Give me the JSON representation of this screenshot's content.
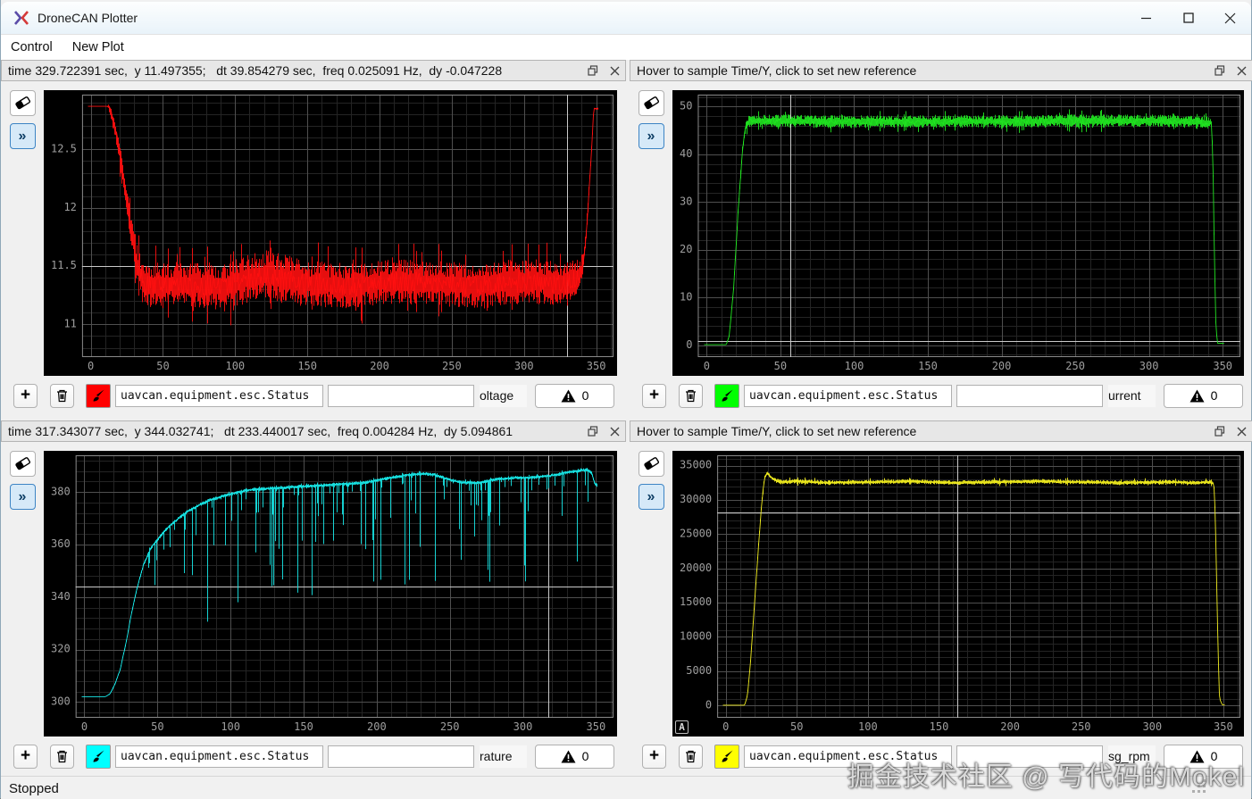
{
  "window": {
    "title": "DroneCAN Plotter",
    "status": "Stopped",
    "watermark": "掘金技术社区 @ 写代码的Mokel"
  },
  "menu": {
    "items": [
      {
        "label": "Control"
      },
      {
        "label": "New Plot"
      }
    ]
  },
  "panels": [
    {
      "header": "time 329.722391 sec,  y 11.497355;   dt 39.854279 sec,  freq 0.025091 Hz,  dy -0.047228",
      "signal": "uavcan.equipment.esc.Status",
      "value_field": "",
      "subfield": "oltage",
      "warn_count": "0",
      "color": "#ff1010"
    },
    {
      "header": "Hover to sample Time/Y, click to set new reference",
      "signal": "uavcan.equipment.esc.Status",
      "value_field": "",
      "subfield": "urrent",
      "warn_count": "0",
      "color": "#21e521"
    },
    {
      "header": "time 317.343077 sec,  y 344.032741;   dt 233.440017 sec,  freq 0.004284 Hz,  dy 5.094861",
      "signal": "uavcan.equipment.esc.Status",
      "value_field": "",
      "subfield": "rature",
      "warn_count": "0",
      "color": "#18e8e8"
    },
    {
      "header": "Hover to sample Time/Y, click to set new reference",
      "signal": "uavcan.equipment.esc.Status",
      "value_field": "",
      "subfield": "sg_rpm",
      "warn_count": "0",
      "color": "#f2ee1f",
      "autoscale_badge": "A"
    }
  ],
  "chart_data": [
    {
      "type": "line",
      "color": "#ff1010",
      "seed": 11,
      "xlim": [
        -6,
        362
      ],
      "ylim": [
        10.72,
        12.97
      ],
      "x_ticks": [
        0,
        50,
        100,
        150,
        200,
        250,
        300,
        350
      ],
      "x_minor": 10,
      "y_ticks": [
        11,
        11.5,
        12,
        12.5
      ],
      "y_minor": 0.1,
      "crosshair": {
        "x": 329.72,
        "y": 11.497
      },
      "baseline": [
        [
          -2,
          12.87
        ],
        [
          12,
          12.87
        ],
        [
          14,
          12.8
        ],
        [
          17,
          12.65
        ],
        [
          20,
          12.45
        ],
        [
          23,
          12.2
        ],
        [
          26,
          11.95
        ],
        [
          28,
          11.8
        ],
        [
          31,
          11.55
        ],
        [
          34,
          11.42
        ],
        [
          38,
          11.33
        ],
        [
          60,
          11.35
        ],
        [
          90,
          11.32
        ],
        [
          120,
          11.43
        ],
        [
          150,
          11.35
        ],
        [
          180,
          11.33
        ],
        [
          210,
          11.37
        ],
        [
          240,
          11.35
        ],
        [
          270,
          11.33
        ],
        [
          300,
          11.37
        ],
        [
          330,
          11.35
        ],
        [
          338,
          11.4
        ],
        [
          341,
          11.55
        ],
        [
          343,
          11.8
        ],
        [
          345,
          12.2
        ],
        [
          347,
          12.6
        ],
        [
          348,
          12.85
        ],
        [
          351,
          12.85
        ]
      ],
      "noise": [
        [
          -2,
          0
        ],
        [
          11,
          0
        ],
        [
          14,
          0.06
        ],
        [
          20,
          0.1
        ],
        [
          30,
          0.15
        ],
        [
          36,
          0.2
        ],
        [
          60,
          0.19
        ],
        [
          120,
          0.21
        ],
        [
          200,
          0.19
        ],
        [
          300,
          0.2
        ],
        [
          336,
          0.18
        ],
        [
          341,
          0.1
        ],
        [
          345,
          0.04
        ],
        [
          348,
          0.01
        ],
        [
          351,
          0.01
        ]
      ]
    },
    {
      "type": "line",
      "color": "#21e521",
      "seed": 22,
      "xlim": [
        -6,
        362
      ],
      "ylim": [
        -2.5,
        52.5
      ],
      "x_ticks": [
        0,
        50,
        100,
        150,
        200,
        250,
        300,
        350
      ],
      "x_minor": 10,
      "y_ticks": [
        0,
        10,
        20,
        30,
        40,
        50
      ],
      "y_minor": 2,
      "crosshair": {
        "x": 57,
        "y": 0.8
      },
      "baseline": [
        [
          -2,
          0.1
        ],
        [
          13,
          0.1
        ],
        [
          15,
          2
        ],
        [
          18,
          12
        ],
        [
          21,
          28
        ],
        [
          24,
          41
        ],
        [
          26,
          45.5
        ],
        [
          28,
          46.8
        ],
        [
          40,
          47
        ],
        [
          100,
          46.8
        ],
        [
          200,
          46.9
        ],
        [
          300,
          47
        ],
        [
          335,
          46.8
        ],
        [
          342,
          46.5
        ],
        [
          343,
          40
        ],
        [
          344,
          20
        ],
        [
          345,
          5
        ],
        [
          346,
          0.4
        ],
        [
          351,
          0.4
        ]
      ],
      "noise": [
        [
          -2,
          0
        ],
        [
          13,
          0
        ],
        [
          15,
          0.3
        ],
        [
          24,
          0.8
        ],
        [
          28,
          1.3
        ],
        [
          60,
          1.4
        ],
        [
          150,
          1.3
        ],
        [
          250,
          1.4
        ],
        [
          340,
          1.3
        ],
        [
          343,
          0.4
        ],
        [
          346,
          0.05
        ],
        [
          351,
          0.05
        ]
      ]
    },
    {
      "type": "line",
      "color": "#18e8e8",
      "seed": 33,
      "xlim": [
        -6,
        362
      ],
      "ylim": [
        294,
        394
      ],
      "x_ticks": [
        0,
        50,
        100,
        150,
        200,
        250,
        300,
        350
      ],
      "x_minor": 10,
      "y_ticks": [
        300,
        320,
        340,
        360,
        380
      ],
      "y_minor": 4,
      "crosshair": {
        "x": 317.34,
        "y": 344.03
      },
      "baseline": [
        [
          -2,
          302
        ],
        [
          14,
          302
        ],
        [
          17,
          303
        ],
        [
          20,
          306
        ],
        [
          24,
          312
        ],
        [
          28,
          322
        ],
        [
          32,
          334
        ],
        [
          36,
          344
        ],
        [
          40,
          352
        ],
        [
          45,
          358.5
        ],
        [
          50,
          362
        ],
        [
          56,
          366
        ],
        [
          62,
          369
        ],
        [
          70,
          372.5
        ],
        [
          78,
          375
        ],
        [
          86,
          377
        ],
        [
          95,
          378.5
        ],
        [
          105,
          380
        ],
        [
          115,
          381
        ],
        [
          130,
          381.5
        ],
        [
          145,
          382
        ],
        [
          160,
          382.5
        ],
        [
          175,
          383
        ],
        [
          190,
          383.5
        ],
        [
          200,
          384.5
        ],
        [
          210,
          385.5
        ],
        [
          220,
          386.5
        ],
        [
          232,
          387
        ],
        [
          240,
          386.5
        ],
        [
          248,
          385
        ],
        [
          255,
          384
        ],
        [
          262,
          383.5
        ],
        [
          270,
          383.5
        ],
        [
          278,
          384.5
        ],
        [
          285,
          385
        ],
        [
          295,
          385.5
        ],
        [
          305,
          385.5
        ],
        [
          315,
          386
        ],
        [
          322,
          386.5
        ],
        [
          330,
          387.5
        ],
        [
          336,
          388
        ],
        [
          344,
          388.5
        ],
        [
          347,
          387
        ],
        [
          349,
          383
        ],
        [
          351,
          382.5
        ]
      ],
      "noise": [
        [
          -2,
          0
        ],
        [
          14,
          0
        ],
        [
          18,
          0.3
        ],
        [
          40,
          0.7
        ],
        [
          351,
          0.7
        ]
      ],
      "spikes": {
        "start": 40,
        "end": 348,
        "prob": 0.2,
        "min": 3,
        "max": 48
      }
    },
    {
      "type": "line",
      "color": "#f2ee1f",
      "seed": 44,
      "xlim": [
        -6,
        362
      ],
      "ylim": [
        -1800,
        36500
      ],
      "x_ticks": [
        0,
        50,
        100,
        150,
        200,
        250,
        300,
        350
      ],
      "x_minor": 10,
      "y_ticks": [
        0,
        5000,
        10000,
        15000,
        20000,
        25000,
        30000,
        35000
      ],
      "y_minor": 1000,
      "crosshair": {
        "x": 163,
        "y": 28100
      },
      "baseline": [
        [
          -2,
          30
        ],
        [
          13,
          30
        ],
        [
          15,
          1500
        ],
        [
          17,
          6000
        ],
        [
          19,
          12000
        ],
        [
          21,
          18000
        ],
        [
          23,
          24000
        ],
        [
          25,
          29500
        ],
        [
          27,
          33300
        ],
        [
          29,
          33900
        ],
        [
          31,
          33400
        ],
        [
          34,
          32900
        ],
        [
          38,
          32600
        ],
        [
          50,
          32700
        ],
        [
          70,
          32500
        ],
        [
          100,
          32600
        ],
        [
          130,
          32700
        ],
        [
          160,
          32500
        ],
        [
          190,
          32600
        ],
        [
          220,
          32700
        ],
        [
          250,
          32600
        ],
        [
          280,
          32500
        ],
        [
          310,
          32600
        ],
        [
          330,
          32500
        ],
        [
          340,
          32600
        ],
        [
          343,
          32400
        ],
        [
          344,
          28000
        ],
        [
          345,
          18000
        ],
        [
          346,
          8000
        ],
        [
          347,
          1000
        ],
        [
          349,
          60
        ],
        [
          351,
          60
        ]
      ],
      "noise": [
        [
          -2,
          0
        ],
        [
          13,
          0
        ],
        [
          15,
          100
        ],
        [
          27,
          300
        ],
        [
          40,
          360
        ],
        [
          100,
          330
        ],
        [
          200,
          340
        ],
        [
          300,
          330
        ],
        [
          342,
          300
        ],
        [
          344,
          100
        ],
        [
          347,
          20
        ],
        [
          351,
          10
        ]
      ]
    }
  ],
  "icons": {
    "warning": "warning-triangle",
    "eraser": "eraser",
    "chevrons": "»",
    "plus": "+"
  }
}
